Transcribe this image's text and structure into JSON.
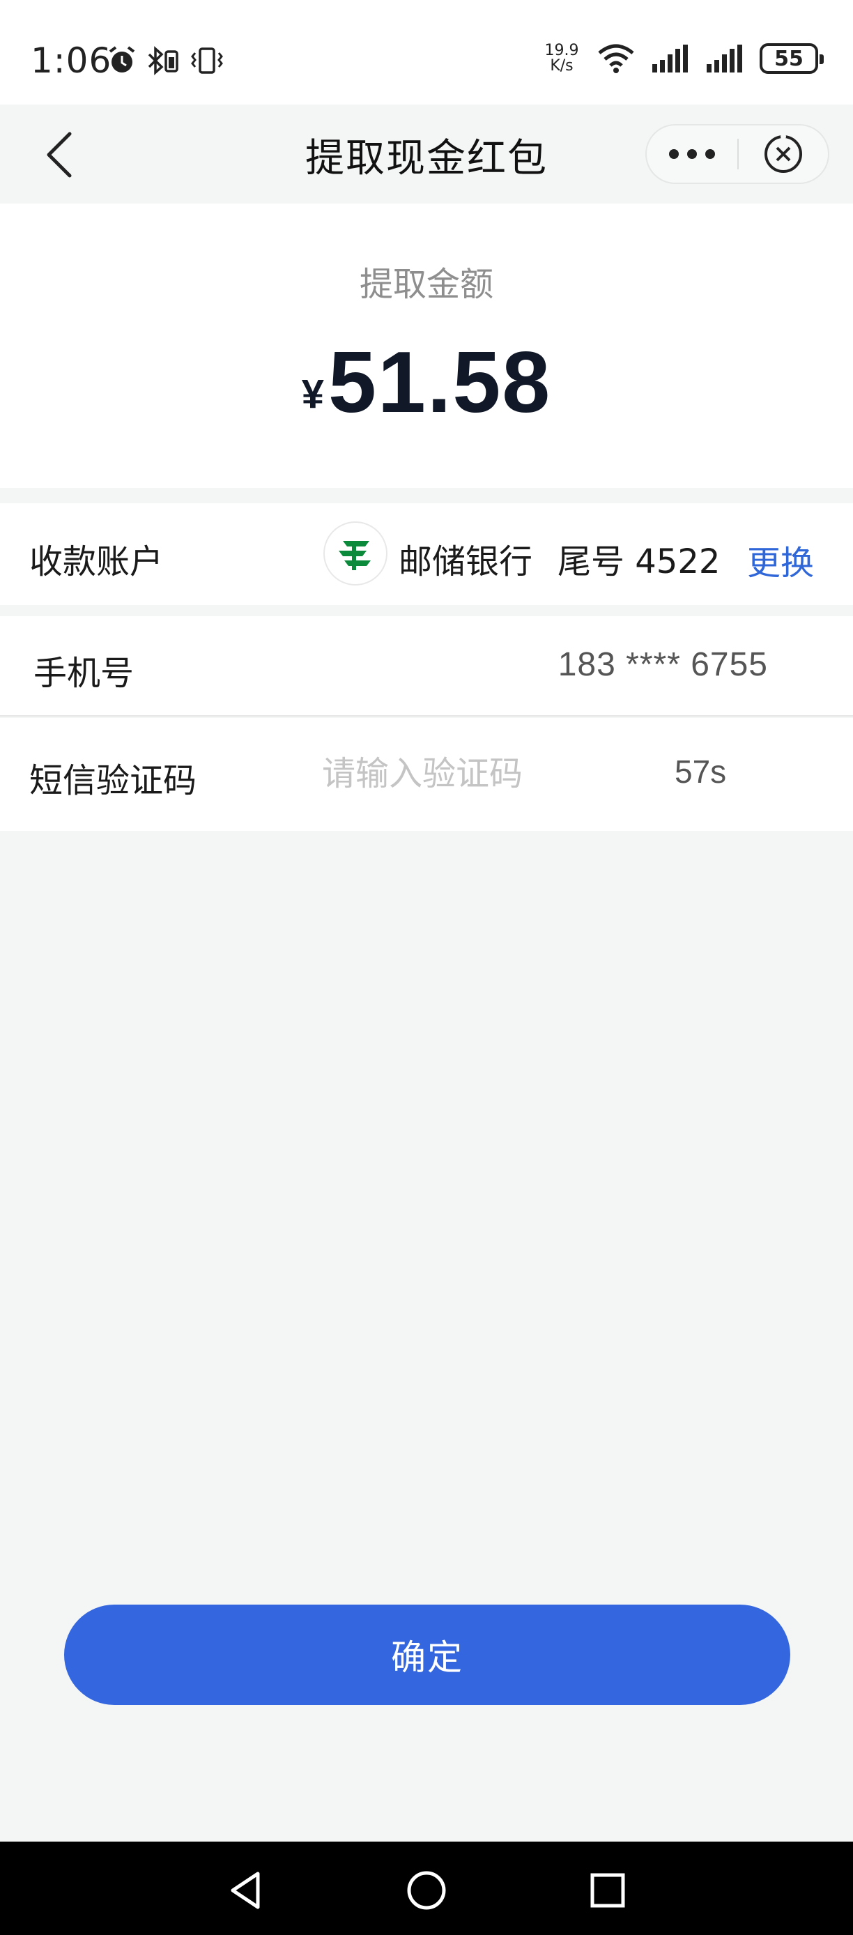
{
  "status_bar": {
    "time": "1:06",
    "net_speed_value": "19.9",
    "net_speed_unit": "K/s",
    "battery": "55",
    "icons": [
      "alarm-icon",
      "bluetooth-icon",
      "vibrate-icon",
      "wifi-icon",
      "signal-icon",
      "signal-icon",
      "battery-icon"
    ]
  },
  "header": {
    "title": "提取现金红包",
    "icons": [
      "back-arrow-icon",
      "more-dots-icon",
      "close-circle-icon"
    ]
  },
  "amount": {
    "label": "提取金额",
    "currency": "¥",
    "value": "51.58"
  },
  "account_row": {
    "label": "收款账户",
    "bank_icon": "postal-savings-bank-logo",
    "bank_name": "邮储银行",
    "tail": "尾号 4522",
    "change_label": "更换"
  },
  "phone_row": {
    "label": "手机号",
    "value": "183 **** 6755"
  },
  "sms_row": {
    "label": "短信验证码",
    "placeholder": "请输入验证码",
    "countdown": "57s"
  },
  "confirm_label": "确定",
  "nav_bar": {
    "icons": [
      "nav-back-icon",
      "nav-home-icon",
      "nav-recents-icon"
    ]
  },
  "colors": {
    "accent": "#3467df",
    "link": "#2f66d8",
    "bank_green": "#0a8a3a",
    "background": "#f4f5f5"
  }
}
